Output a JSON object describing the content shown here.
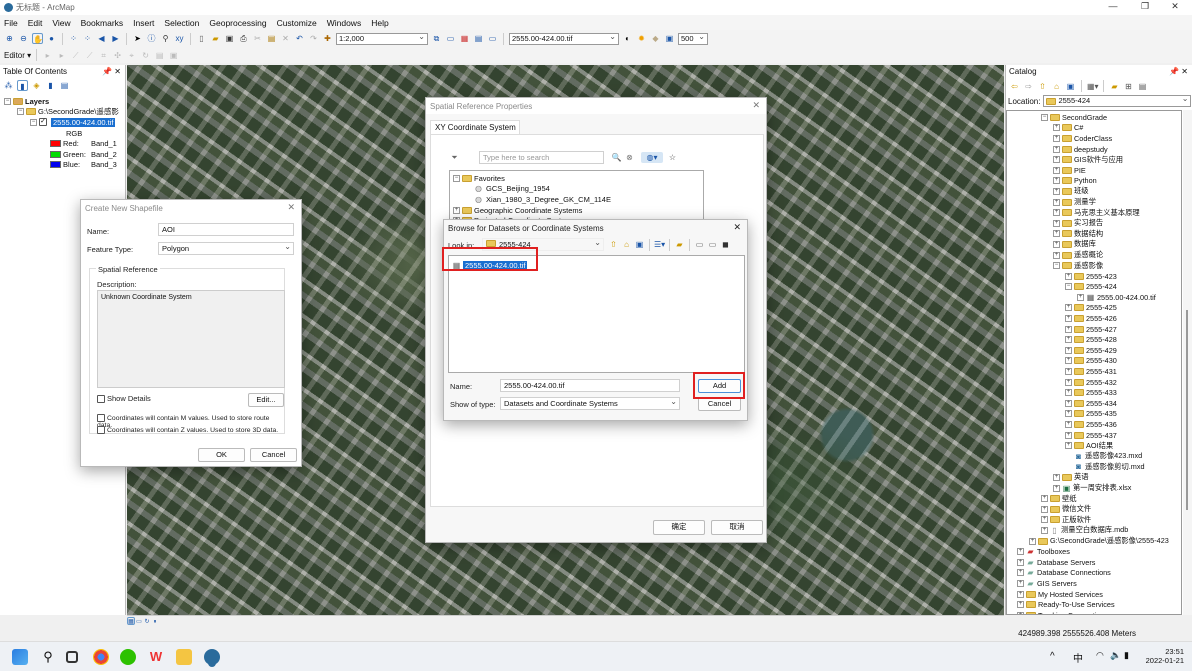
{
  "window": {
    "title": "无标题 - ArcMap",
    "min": "—",
    "max": "❐",
    "close": "✕"
  },
  "menu": [
    "File",
    "Edit",
    "View",
    "Bookmarks",
    "Insert",
    "Selection",
    "Geoprocessing",
    "Customize",
    "Windows",
    "Help"
  ],
  "toolbar": {
    "scale": "1:2,000",
    "layer": "2555.00-424.00.tif",
    "value": "500",
    "editor": "Editor"
  },
  "toc": {
    "title": "Table Of Contents",
    "layers": "Layers",
    "group": "G:\\SecondGrade\\遥感影",
    "raster": "2555.00-424.00.tif",
    "rgb": "RGB",
    "bands": [
      {
        "label": "Red:",
        "band": "Band_1",
        "color": "#ff0000"
      },
      {
        "label": "Green:",
        "band": "Band_2",
        "color": "#00dd00"
      },
      {
        "label": "Blue:",
        "band": "Band_3",
        "color": "#0000ee"
      }
    ]
  },
  "shapefile": {
    "title": "Create New Shapefile",
    "name_label": "Name:",
    "name_value": "AOI",
    "type_label": "Feature Type:",
    "type_value": "Polygon",
    "sr_label": "Spatial Reference",
    "desc_label": "Description:",
    "desc_value": "Unknown Coordinate System",
    "show_details": "Show Details",
    "edit": "Edit...",
    "m_values": "Coordinates will contain M values. Used to store route data.",
    "z_values": "Coordinates will contain Z values. Used to store 3D data.",
    "ok": "OK",
    "cancel": "Cancel"
  },
  "srp": {
    "title": "Spatial Reference Properties",
    "tab": "XY Coordinate System",
    "search_placeholder": "Type here to search",
    "favorites": "Favorites",
    "fav_items": [
      "GCS_Beijing_1954",
      "Xian_1980_3_Degree_GK_CM_114E"
    ],
    "geo": "Geographic Coordinate Systems",
    "proj": "Projected Coordinate Systems",
    "ok": "确定",
    "cancel": "取消"
  },
  "browse": {
    "title": "Browse for Datasets or Coordinate Systems",
    "look_in_label": "Look in:",
    "look_in": "2555-424",
    "selected": "2555.00-424.00.tif",
    "name_label": "Name:",
    "name_value": "2555.00-424.00.tif",
    "type_label": "Show of type:",
    "type_value": "Datasets and Coordinate Systems",
    "add": "Add",
    "cancel": "Cancel"
  },
  "catalog": {
    "title": "Catalog",
    "location_label": "Location:",
    "location": "2555-424",
    "items": [
      {
        "t": "SecondGrade",
        "l": 3,
        "o": true
      },
      {
        "t": "C#",
        "l": 4
      },
      {
        "t": "CoderClass",
        "l": 4
      },
      {
        "t": "deepstudy",
        "l": 4
      },
      {
        "t": "GIS软件与应用",
        "l": 4
      },
      {
        "t": "PIE",
        "l": 4
      },
      {
        "t": "Python",
        "l": 4
      },
      {
        "t": "班级",
        "l": 4
      },
      {
        "t": "测量学",
        "l": 4
      },
      {
        "t": "马克思主义基本原理",
        "l": 4
      },
      {
        "t": "实习报告",
        "l": 4
      },
      {
        "t": "数据结构",
        "l": 4
      },
      {
        "t": "数据库",
        "l": 4
      },
      {
        "t": "遥感概论",
        "l": 4
      },
      {
        "t": "遥感影像",
        "l": 4,
        "o": true
      },
      {
        "t": "2555-423",
        "l": 5
      },
      {
        "t": "2555-424",
        "l": 5,
        "o": true
      },
      {
        "t": "2555.00-424.00.tif",
        "l": 6,
        "k": "raster"
      },
      {
        "t": "2555-425",
        "l": 5
      },
      {
        "t": "2555-426",
        "l": 5
      },
      {
        "t": "2555-427",
        "l": 5
      },
      {
        "t": "2555-428",
        "l": 5
      },
      {
        "t": "2555-429",
        "l": 5
      },
      {
        "t": "2555-430",
        "l": 5
      },
      {
        "t": "2555-431",
        "l": 5
      },
      {
        "t": "2555-432",
        "l": 5
      },
      {
        "t": "2555-433",
        "l": 5
      },
      {
        "t": "2555-434",
        "l": 5
      },
      {
        "t": "2555-435",
        "l": 5
      },
      {
        "t": "2555-436",
        "l": 5
      },
      {
        "t": "2555-437",
        "l": 5
      },
      {
        "t": "AOI结果",
        "l": 5
      },
      {
        "t": "遥感影像423.mxd",
        "l": 5,
        "k": "mxd"
      },
      {
        "t": "遥感影像剪切.mxd",
        "l": 5,
        "k": "mxd"
      },
      {
        "t": "英语",
        "l": 4
      },
      {
        "t": "第一周安排表.xlsx",
        "l": 4,
        "k": "xls"
      },
      {
        "t": "壁纸",
        "l": 3
      },
      {
        "t": "微信文件",
        "l": 3
      },
      {
        "t": "正版软件",
        "l": 3
      },
      {
        "t": "测量空白数据库.mdb",
        "l": 3,
        "k": "mdb"
      },
      {
        "t": "G:\\SecondGrade\\遥感影像\\2555-423",
        "l": 2
      },
      {
        "t": "Toolboxes",
        "l": 1,
        "k": "tool"
      },
      {
        "t": "Database Servers",
        "l": 1,
        "k": "db"
      },
      {
        "t": "Database Connections",
        "l": 1,
        "k": "db"
      },
      {
        "t": "GIS Servers",
        "l": 1,
        "k": "db"
      },
      {
        "t": "My Hosted Services",
        "l": 1
      },
      {
        "t": "Ready-To-Use Services",
        "l": 1
      },
      {
        "t": "Tracking Connections",
        "l": 1
      }
    ]
  },
  "status": {
    "coords": "424989.398  2555526.408 Meters"
  },
  "taskbar": {
    "ime": "中",
    "time": "23:51",
    "date": "2022-01-21"
  }
}
